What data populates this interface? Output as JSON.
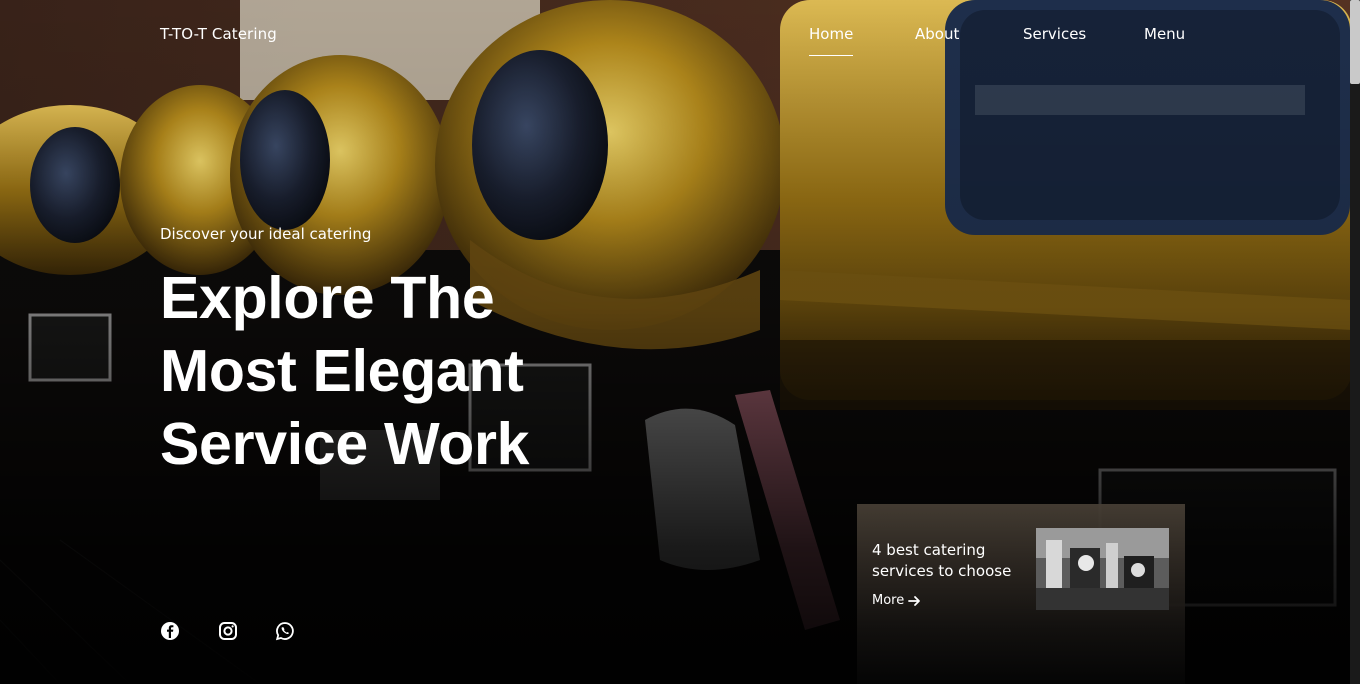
{
  "header": {
    "brand": "T-TO-T Catering",
    "nav": [
      {
        "label": "Home",
        "active": true
      },
      {
        "label": "About",
        "active": false
      },
      {
        "label": "Services",
        "active": false
      },
      {
        "label": "Menu",
        "active": false
      }
    ]
  },
  "hero": {
    "eyebrow": "Discover your ideal catering",
    "headline_lines": [
      "Explore The",
      "Most Elegant",
      "Service Work"
    ]
  },
  "card": {
    "title": "4 best catering services to choose",
    "more_label": "More",
    "more_icon": "arrow-right-icon",
    "image_icon": "event-photo"
  },
  "social": [
    {
      "name": "facebook-icon"
    },
    {
      "name": "instagram-icon"
    },
    {
      "name": "whatsapp-icon"
    }
  ],
  "colors": {
    "text": "#ffffff",
    "gold": "#b8901e",
    "overlay": "#000000",
    "card": "#3a342c"
  }
}
